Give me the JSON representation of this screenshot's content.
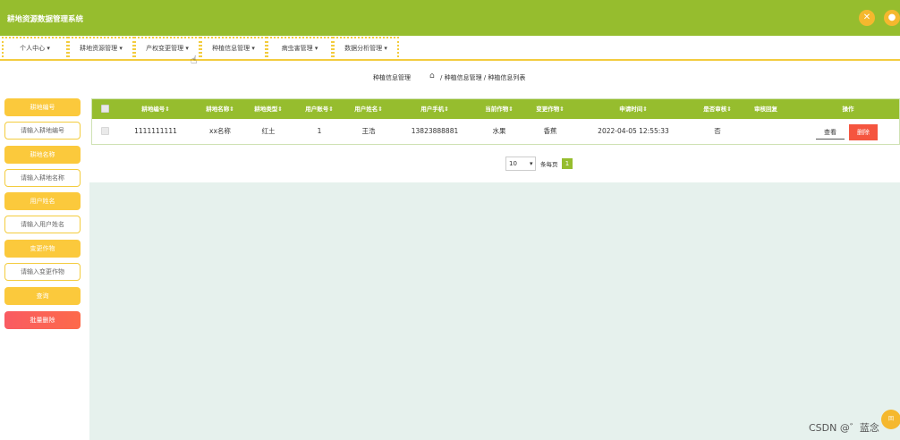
{
  "app": {
    "title": "耕地资源数据管理系统"
  },
  "top_icons": [
    {
      "name": "close-icon",
      "glyph": "✕",
      "color": "#f5b82e"
    },
    {
      "name": "user-icon",
      "glyph": "●",
      "color": "#f5b82e"
    }
  ],
  "nav": {
    "items": [
      {
        "label": "个人中心 ▾"
      },
      {
        "label": "耕地资源管理 ▾"
      },
      {
        "label": "产权变更管理 ▾"
      },
      {
        "label": "种植信息管理 ▾"
      },
      {
        "label": "病虫害管理 ▾"
      },
      {
        "label": "数据分析管理 ▾"
      }
    ]
  },
  "breadcrumb": {
    "title": "种植信息管理",
    "path": "/ 种植信息管理 / 种植信息列表"
  },
  "sidebar": {
    "fields": [
      {
        "label": "耕地编号",
        "placeholder": "请输入耕地编号"
      },
      {
        "label": "耕地名称",
        "placeholder": "请输入耕地名称"
      },
      {
        "label": "用户姓名",
        "placeholder": "请输入用户姓名"
      },
      {
        "label": "变更作物",
        "placeholder": "请输入变更作物"
      }
    ],
    "query_label": "查询",
    "batch_delete_label": "批量删除"
  },
  "table": {
    "columns": [
      "耕地编号",
      "耕地名称",
      "耕地类型",
      "用户账号",
      "用户姓名",
      "用户手机",
      "当前作物",
      "变更作物",
      "申请时间",
      "是否审核",
      "审核回复",
      "操作"
    ],
    "rows": [
      {
        "cells": [
          "1111111111",
          "xx名称",
          "红土",
          "1",
          "王浩",
          "13823888881",
          "水果",
          "香蕉",
          "2022-04-05 12:55:33",
          "否",
          ""
        ]
      }
    ],
    "view_label": "查看",
    "delete_label": "删除"
  },
  "pagination": {
    "page_size": "10",
    "per_page_label": "条每页",
    "current_page": "1"
  },
  "watermark": "CSDN @゛蓝念",
  "float_badge": {
    "label": "回"
  },
  "colors": {
    "primary": "#96bd2e",
    "accent": "#fbc93c",
    "danger": "#f5553f",
    "border": "#f3cc3e"
  }
}
